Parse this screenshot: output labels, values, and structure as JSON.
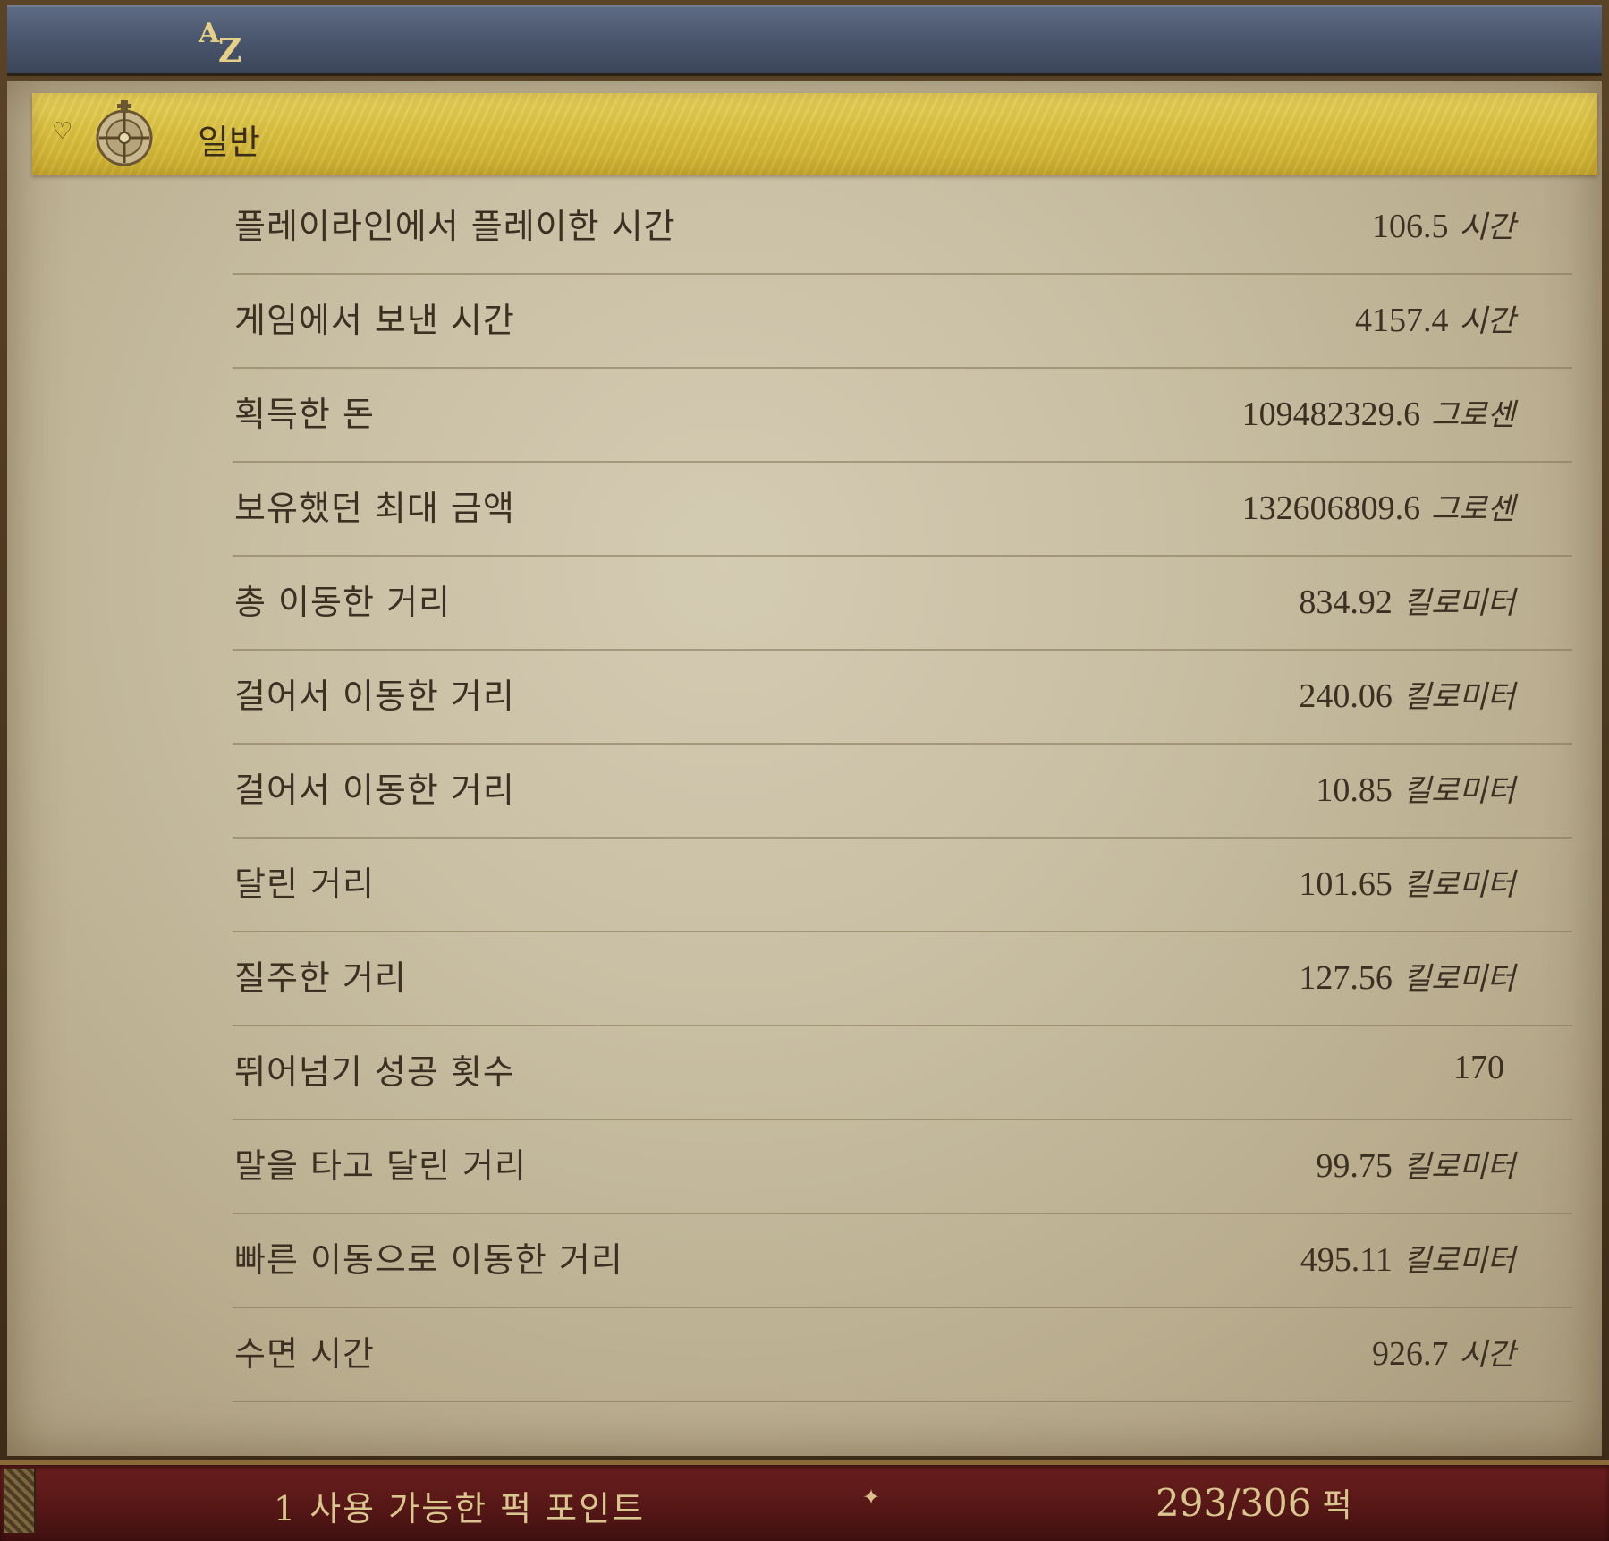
{
  "sort_icon": {
    "a": "A",
    "z": "Z"
  },
  "category": {
    "label": "일반",
    "icon": "orb-emblem-icon",
    "chevron": "chevron-heart-icon"
  },
  "stats": [
    {
      "label": "플레이라인에서 플레이한 시간",
      "value": "106.5",
      "unit": "시간"
    },
    {
      "label": "게임에서 보낸 시간",
      "value": "4157.4",
      "unit": "시간"
    },
    {
      "label": "획득한 돈",
      "value": "109482329.6",
      "unit": "그로센"
    },
    {
      "label": "보유했던 최대 금액",
      "value": "132606809.6",
      "unit": "그로센"
    },
    {
      "label": "총 이동한 거리",
      "value": "834.92",
      "unit": "킬로미터"
    },
    {
      "label": "걸어서 이동한 거리",
      "value": "240.06",
      "unit": "킬로미터"
    },
    {
      "label": "걸어서 이동한 거리",
      "value": "10.85",
      "unit": "킬로미터"
    },
    {
      "label": "달린 거리",
      "value": "101.65",
      "unit": "킬로미터"
    },
    {
      "label": "질주한 거리",
      "value": "127.56",
      "unit": "킬로미터"
    },
    {
      "label": "뛰어넘기 성공 횟수",
      "value": "170",
      "unit": ""
    },
    {
      "label": "말을 타고 달린 거리",
      "value": "99.75",
      "unit": "킬로미터"
    },
    {
      "label": "빠른 이동으로 이동한 거리",
      "value": "495.11",
      "unit": "킬로미터"
    },
    {
      "label": "수면 시간",
      "value": "926.7",
      "unit": "시간"
    }
  ],
  "footer": {
    "available_count": "1",
    "available_label": "사용 가능한 퍽 포인트",
    "perks": "293/306",
    "perks_unit": "퍽",
    "divider_icon": "fleur-icon"
  }
}
